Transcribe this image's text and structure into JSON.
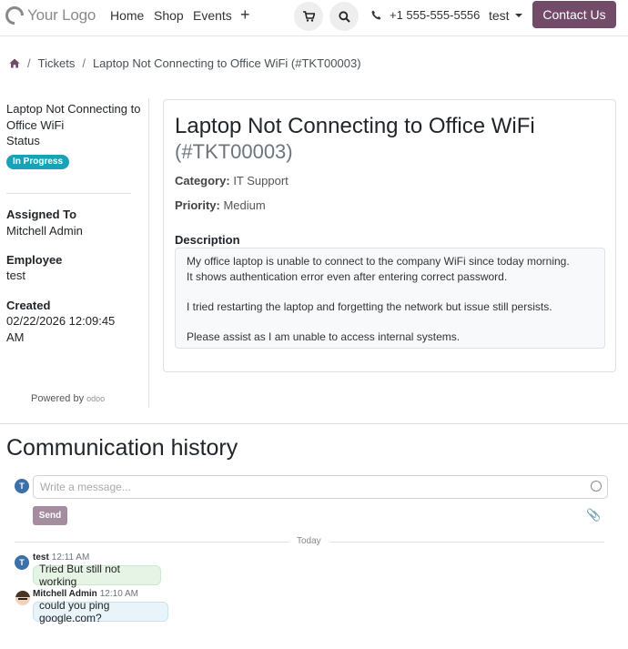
{
  "nav": {
    "logo_text": "Your Logo",
    "links": [
      "Home",
      "Shop",
      "Events"
    ],
    "plus": "+",
    "phone": "+1 555-555-5556",
    "user": "test",
    "contact_label": "Contact Us",
    "icons": [
      "cart-icon",
      "search-icon",
      "phone-icon"
    ]
  },
  "breadcrumb": {
    "home_icon": "home-icon",
    "tickets": "Tickets",
    "current": "Laptop Not Connecting to Office WiFi (#TKT00003)"
  },
  "sidebar": {
    "title": "Laptop Not Connecting to Office WiFi",
    "status_label": "Status",
    "status_value": "In Progress",
    "assigned_label": "Assigned To",
    "assigned_value": "Mitchell Admin",
    "employee_label": "Employee",
    "employee_value": "test",
    "created_label": "Created",
    "created_value": "02/22/2026 12:09:45 AM",
    "powered_by": "Powered by",
    "powered_brand": "odoo"
  },
  "ticket": {
    "title": "Laptop Not Connecting to Office WiFi",
    "number": "(#TKT00003)",
    "category_label": "Category:",
    "category_value": "IT Support",
    "priority_label": "Priority:",
    "priority_value": "Medium",
    "description_label": "Description",
    "description": "My office laptop is unable to connect to the company WiFi since today morning.\nIt shows authentication error even after entering correct password.\n\nI tried restarting the laptop and forgetting the network but issue still persists.\n\nPlease assist as I am unable to access internal systems."
  },
  "communication": {
    "title": "Communication history",
    "composer_avatar": "T",
    "placeholder": "Write a message...",
    "send_label": "Send",
    "day_separator": "Today",
    "messages": [
      {
        "avatar": "T",
        "author": "test",
        "time": "12:11 AM",
        "text": "Tried But still not working"
      },
      {
        "avatar": "",
        "author": "Mitchell Admin",
        "time": "12:10 AM",
        "text": "could you ping google.com?"
      }
    ]
  },
  "colors": {
    "brand": "#714B67",
    "badge": "#17a2b8",
    "avatar": "#3d6fa8"
  }
}
